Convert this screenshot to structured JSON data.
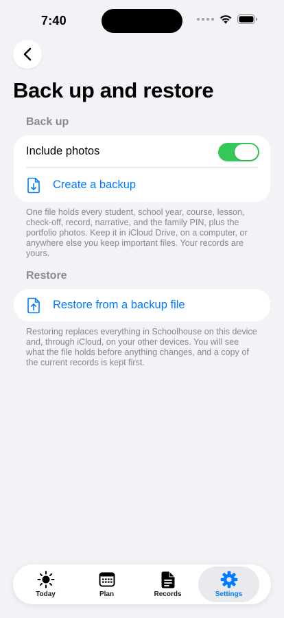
{
  "status_bar": {
    "time": "7:40"
  },
  "nav": {
    "back_icon": "chevron-left-icon",
    "title": "Back up and restore"
  },
  "backup": {
    "header": "Back up",
    "include_photos_label": "Include photos",
    "include_photos_on": true,
    "create_label": "Create a backup",
    "create_icon": "document-download-icon",
    "footnote": "One file holds every student, school year, course, lesson, check-off, record, narrative, and the family PIN, plus the portfolio photos. Keep it in iCloud Drive, on a computer, or anywhere else you keep important files. Your records are yours."
  },
  "restore": {
    "header": "Restore",
    "restore_label": "Restore from a backup file",
    "restore_icon": "document-upload-icon",
    "footnote": "Restoring replaces everything in Schoolhouse on this device and, through iCloud, on your other devices. You will see what the file holds before anything changes, and a copy of the current records is kept first."
  },
  "tabs": [
    {
      "label": "Today",
      "icon": "sun-icon",
      "active": false
    },
    {
      "label": "Plan",
      "icon": "calendar-icon",
      "active": false
    },
    {
      "label": "Records",
      "icon": "document-icon",
      "active": false
    },
    {
      "label": "Settings",
      "icon": "gear-icon",
      "active": true
    }
  ],
  "colors": {
    "accent": "#007aff",
    "toggle_on": "#34c759",
    "background": "#f2f2f7"
  }
}
